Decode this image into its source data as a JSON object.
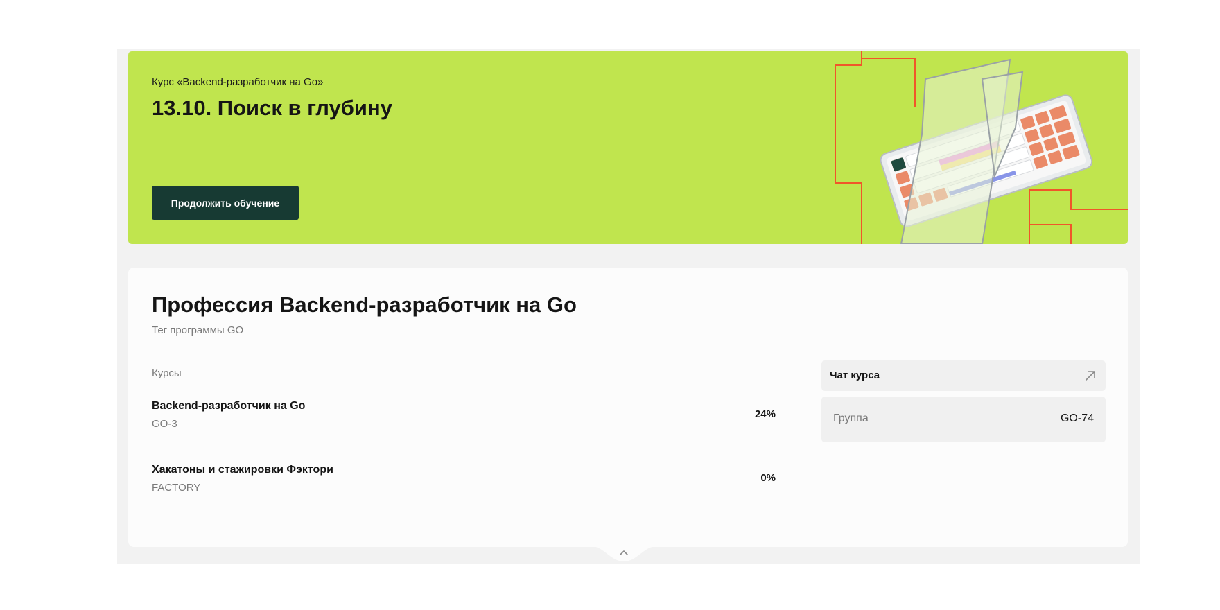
{
  "banner": {
    "course_name": "Курс «Backend-разработчик на Go»",
    "lesson_title": "13.10. Поиск в глубину",
    "continue_label": "Продолжить обучение",
    "background_color": "#c0e54e",
    "button_color": "#173a33",
    "illustration_icon": "keyboard-illustration"
  },
  "program": {
    "title": "Профессия Backend-разработчик на Go",
    "tag": "Тег программы GO",
    "courses_label": "Курсы",
    "courses": [
      {
        "name": "Backend-разработчик на Go",
        "code": "GO-3",
        "progress": "24%"
      },
      {
        "name": "Хакатоны и стажировки Фэктори",
        "code": "FACTORY",
        "progress": "0%"
      }
    ],
    "chat": {
      "label": "Чат курса",
      "icon": "arrow-up-right-icon"
    },
    "group": {
      "label": "Группа",
      "value": "GO-74"
    }
  },
  "collapse_icon": "chevron-up-icon"
}
